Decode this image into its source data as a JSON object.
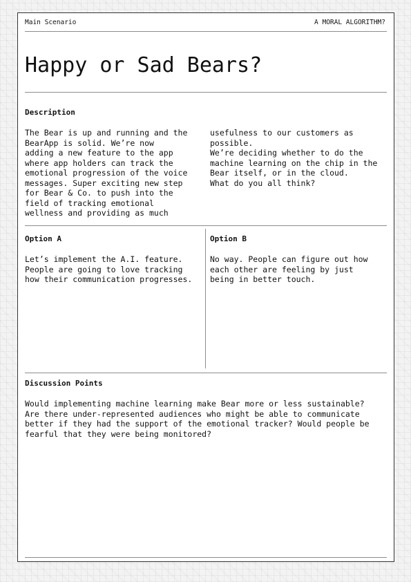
{
  "header": {
    "section_label": "Main Scenario",
    "series_label": "A MORAL ALGORITHM?"
  },
  "title": "Happy or Sad Bears?",
  "description": {
    "heading": "Description",
    "column_1": "The Bear is up and running and the\nBearApp is solid. We’re now\nadding a new feature to the app\nwhere app holders can track the\nemotional progression of the voice\nmessages. Super exciting new step\nfor Bear & Co. to push into the\nfield of tracking emotional\nwellness and providing as much",
    "column_2": "usefulness to our customers as\npossible.\nWe’re deciding whether to do the\nmachine learning on the chip in the\nBear itself, or in the cloud.\nWhat do you all think?"
  },
  "option_a": {
    "heading": "Option A",
    "text": "Let’s implement the A.I. feature.\nPeople are going to love tracking\nhow their communication progresses."
  },
  "option_b": {
    "heading": "Option B",
    "text": "No way. People can figure out how\neach other are feeling by just\nbeing in better touch."
  },
  "discussion": {
    "heading": "Discussion Points",
    "text": "Would implementing machine learning make Bear more or less sustainable?\nAre there under-represented audiences who might be able to communicate\nbetter if they had the support of the emotional tracker? Would people be\nfearful that they were being monitored?"
  },
  "colors": {
    "ink": "#111111",
    "rule": "#8c8c8c",
    "card": "#ffffff",
    "background": "#f3f3f3"
  }
}
